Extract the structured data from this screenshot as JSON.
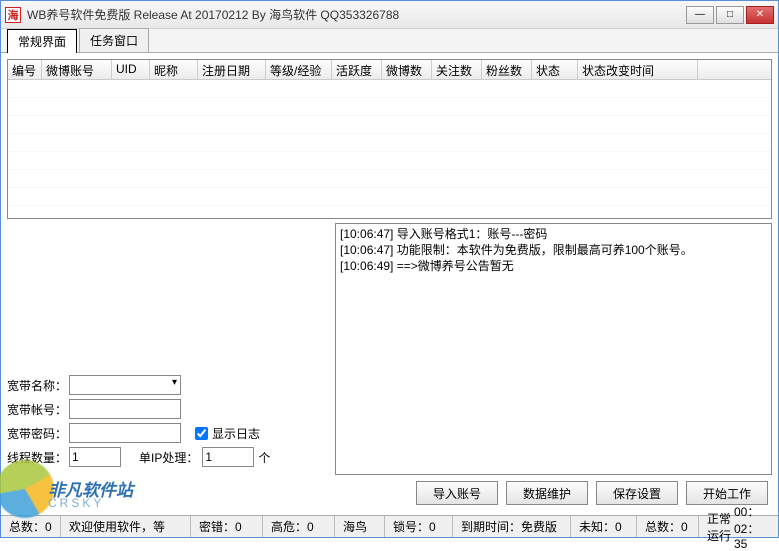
{
  "window": {
    "icon_text": "海",
    "title": "WB养号软件免费版 Release At 20170212 By 海鸟软件 QQ353326788"
  },
  "tabs": [
    {
      "label": "常规界面",
      "active": true
    },
    {
      "label": "任务窗口",
      "active": false
    }
  ],
  "table": {
    "columns": [
      "编号",
      "微博账号",
      "UID",
      "昵称",
      "注册日期",
      "等级/经验",
      "活跃度",
      "微博数",
      "关注数",
      "粉丝数",
      "状态",
      "状态改变时间"
    ],
    "widths": [
      34,
      70,
      38,
      48,
      68,
      66,
      50,
      50,
      50,
      50,
      46,
      120
    ]
  },
  "log": {
    "lines": [
      "[10:06:47] 导入账号格式1：账号---密码",
      "[10:06:47] 功能限制：本软件为免费版，限制最高可养100个账号。",
      "[10:06:49] ==>微博养号公告暂无"
    ]
  },
  "form": {
    "broadband_name_label": "宽带名称：",
    "broadband_name_value": "",
    "broadband_account_label": "宽带帐号：",
    "broadband_account_value": "",
    "broadband_password_label": "宽带密码：",
    "broadband_password_value": "",
    "show_log_label": "显示日志",
    "show_log_checked": true,
    "thread_count_label": "线程数量：",
    "thread_count_value": "1",
    "per_ip_label": "单IP处理：",
    "per_ip_value": "1",
    "per_ip_suffix": "个"
  },
  "buttons": {
    "import": "导入账号",
    "maintain": "数据维护",
    "save": "保存设置",
    "start": "开始工作"
  },
  "status": {
    "total_label": "总数：",
    "total_value": "0",
    "welcome": "欢迎使用软件，等",
    "pwd_err_label": "密错：",
    "pwd_err_value": "0",
    "high_risk_label": "高危：",
    "high_risk_value": "0",
    "brand": "海鸟",
    "lock_label": "锁号：",
    "lock_value": "0",
    "expire_label": "到期时间：",
    "expire_value": "免费版",
    "unknown_label": "未知：",
    "unknown_value": "0",
    "count2_label": "总数：",
    "count2_value": "0",
    "runtime_label": "正常运行",
    "runtime_value": "00：02：35"
  },
  "watermark": {
    "brand": "非凡软件站",
    "domain": "CRSKY"
  }
}
